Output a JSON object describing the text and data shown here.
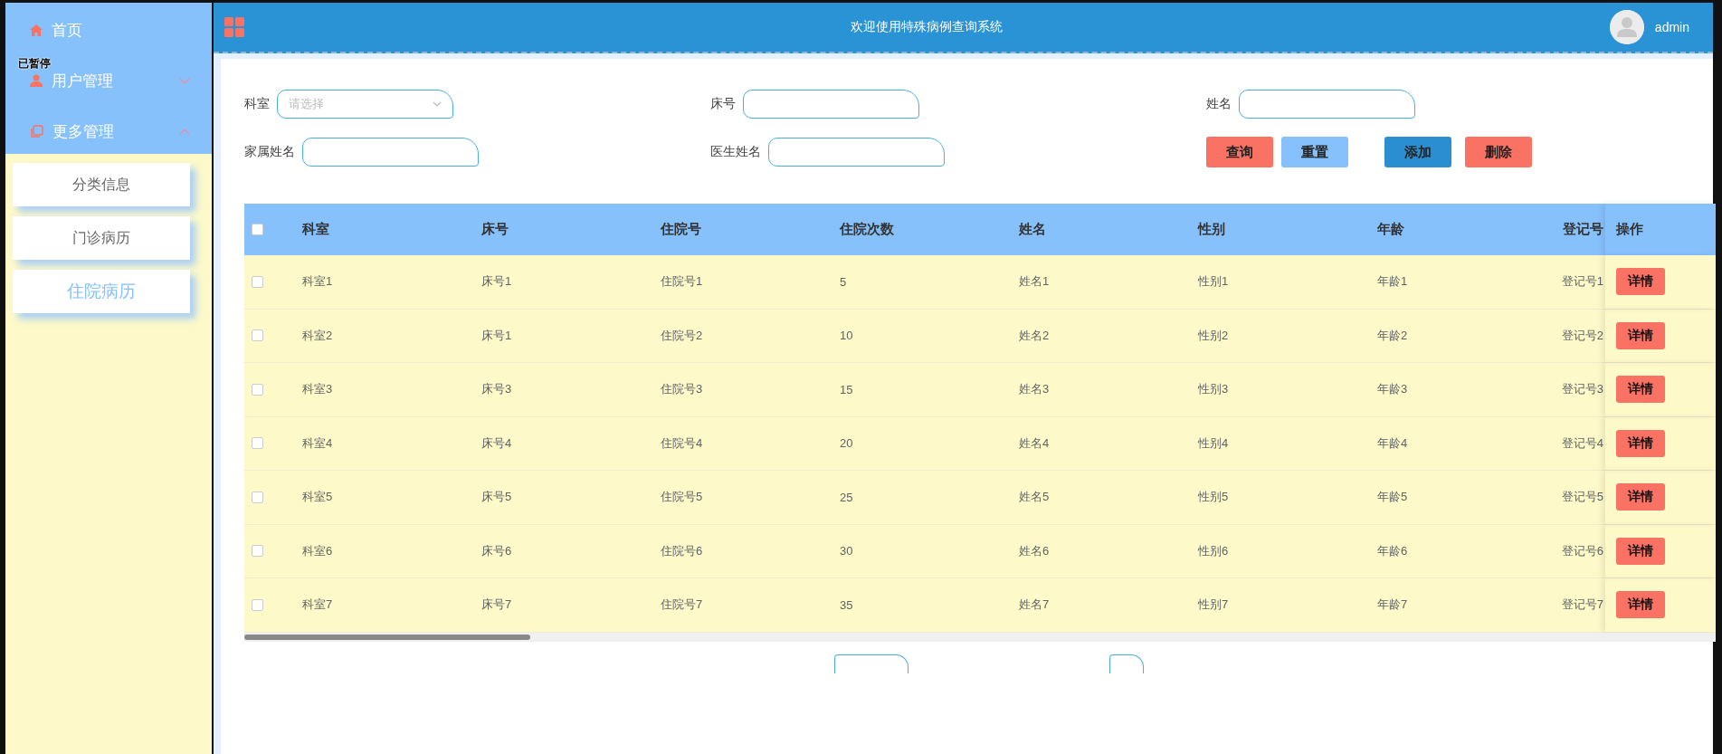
{
  "overlay_label": "已暂停",
  "sidebar": {
    "items": [
      {
        "label": "首页",
        "kind": "home"
      },
      {
        "label": "用户管理",
        "kind": "user",
        "expanded": false
      },
      {
        "label": "更多管理",
        "kind": "pages",
        "expanded": true,
        "children": [
          {
            "label": "分类信息",
            "selected": false
          },
          {
            "label": "门诊病历",
            "selected": false
          },
          {
            "label": "住院病历",
            "selected": true
          }
        ]
      }
    ]
  },
  "header": {
    "title": "欢迎使用特殊病例查询系统",
    "user": "admin"
  },
  "filters": [
    {
      "label": "科室",
      "kind": "select",
      "placeholder": "请选择"
    },
    {
      "label": "床号",
      "kind": "text"
    },
    {
      "label": "姓名",
      "kind": "text"
    },
    {
      "label": "家属姓名",
      "kind": "text"
    },
    {
      "label": "医生姓名",
      "kind": "text"
    }
  ],
  "buttons": [
    {
      "label": "查询",
      "color": "#f97264"
    },
    {
      "label": "重置",
      "color": "#87c1fc"
    },
    {
      "label": "添加",
      "color": "#2a8ed0"
    },
    {
      "label": "删除",
      "color": "#f97264"
    }
  ],
  "table": {
    "header_checked": false,
    "columns": [
      "科室",
      "床号",
      "住院号",
      "住院次数",
      "姓名",
      "性别",
      "年龄",
      "登记号",
      "操作"
    ],
    "rows": [
      {
        "checked": false,
        "cells": [
          "科室1",
          "床号1",
          "住院号1",
          "5",
          "姓名1",
          "性别1",
          "年龄1",
          "登记号1"
        ],
        "action": "详情"
      },
      {
        "checked": false,
        "cells": [
          "科室2",
          "床号1",
          "住院号2",
          "10",
          "姓名2",
          "性别2",
          "年龄2",
          "登记号2"
        ],
        "action": "详情"
      },
      {
        "checked": false,
        "cells": [
          "科室3",
          "床号3",
          "住院号3",
          "15",
          "姓名3",
          "性别3",
          "年龄3",
          "登记号3"
        ],
        "action": "详情"
      },
      {
        "checked": false,
        "cells": [
          "科室4",
          "床号4",
          "住院号4",
          "20",
          "姓名4",
          "性别4",
          "年龄4",
          "登记号4"
        ],
        "action": "详情"
      },
      {
        "checked": false,
        "cells": [
          "科室5",
          "床号5",
          "住院号5",
          "25",
          "姓名5",
          "性别5",
          "年龄5",
          "登记号5"
        ],
        "action": "详情"
      },
      {
        "checked": false,
        "cells": [
          "科室6",
          "床号6",
          "住院号6",
          "30",
          "姓名6",
          "性别6",
          "年龄6",
          "登记号6"
        ],
        "action": "详情"
      },
      {
        "checked": false,
        "cells": [
          "科室7",
          "床号7",
          "住院号7",
          "35",
          "姓名7",
          "性别7",
          "年龄7",
          "登记号7"
        ],
        "action": "详情"
      }
    ]
  }
}
